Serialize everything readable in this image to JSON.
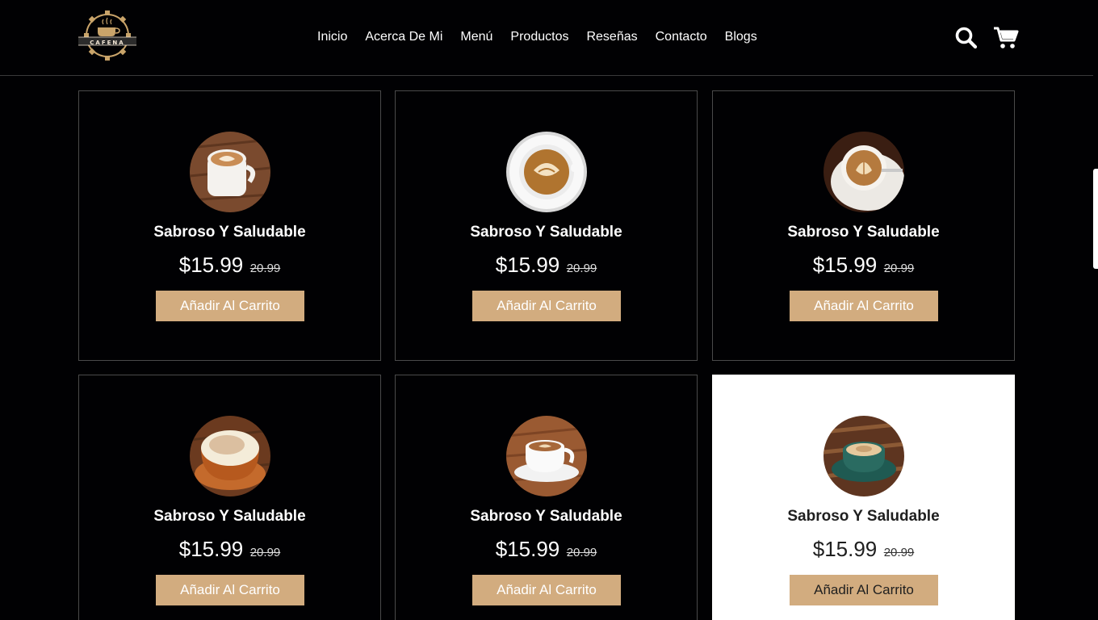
{
  "brand": {
    "logo_text": "CAFENA"
  },
  "nav": {
    "items": [
      {
        "label": "Inicio"
      },
      {
        "label": "Acerca De Mi"
      },
      {
        "label": "Menú"
      },
      {
        "label": "Productos"
      },
      {
        "label": "Reseñas"
      },
      {
        "label": "Contacto"
      },
      {
        "label": "Blogs"
      }
    ]
  },
  "header_icons": {
    "search": "search-icon",
    "cart": "shopping-cart-icon"
  },
  "colors": {
    "background": "#010103",
    "accent": "#d2ac7f",
    "highlight_card": "#ffffff"
  },
  "products": [
    {
      "title": "Sabroso Y Saludable",
      "price": "$15.99",
      "old_price": "20.99",
      "button": "Añadir Al Carrito"
    },
    {
      "title": "Sabroso Y Saludable",
      "price": "$15.99",
      "old_price": "20.99",
      "button": "Añadir Al Carrito"
    },
    {
      "title": "Sabroso Y Saludable",
      "price": "$15.99",
      "old_price": "20.99",
      "button": "Añadir Al Carrito"
    },
    {
      "title": "Sabroso Y Saludable",
      "price": "$15.99",
      "old_price": "20.99",
      "button": "Añadir Al Carrito"
    },
    {
      "title": "Sabroso Y Saludable",
      "price": "$15.99",
      "old_price": "20.99",
      "button": "Añadir Al Carrito"
    },
    {
      "title": "Sabroso Y Saludable",
      "price": "$15.99",
      "old_price": "20.99",
      "button": "Añadir Al Carrito"
    }
  ]
}
